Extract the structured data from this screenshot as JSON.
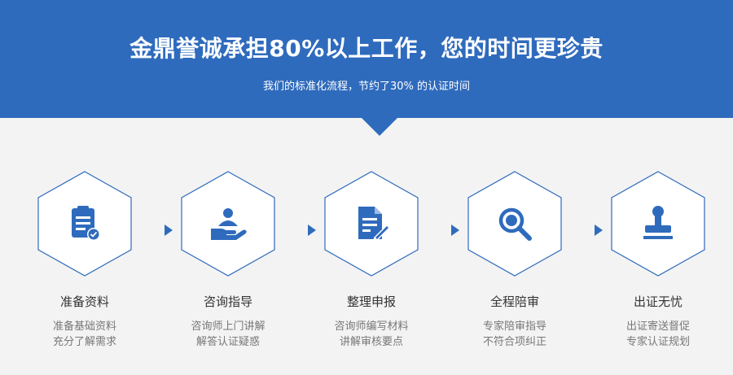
{
  "header": {
    "headline": "金鼎誉诚承担80%以上工作，您的时间更珍贵",
    "subline": "我们的标准化流程，节约了30% 的认证时间"
  },
  "colors": {
    "primary": "#2f6bbd",
    "background": "#f3f3f3"
  },
  "steps": [
    {
      "title": "准备资料",
      "desc1": "准备基础资料",
      "desc2": "充分了解需求",
      "icon": "clipboard-check-icon"
    },
    {
      "title": "咨询指导",
      "desc1": "咨询师上门讲解",
      "desc2": "解答认证疑惑",
      "icon": "consultant-hand-icon"
    },
    {
      "title": "整理申报",
      "desc1": "咨询师编写材料",
      "desc2": "讲解审核要点",
      "icon": "document-edit-icon"
    },
    {
      "title": "全程陪审",
      "desc1": "专家陪审指导",
      "desc2": "不符合项纠正",
      "icon": "magnifier-icon"
    },
    {
      "title": "出证无忧",
      "desc1": "出证寄送督促",
      "desc2": "专家认证规划",
      "icon": "certificate-stamp-icon"
    }
  ]
}
